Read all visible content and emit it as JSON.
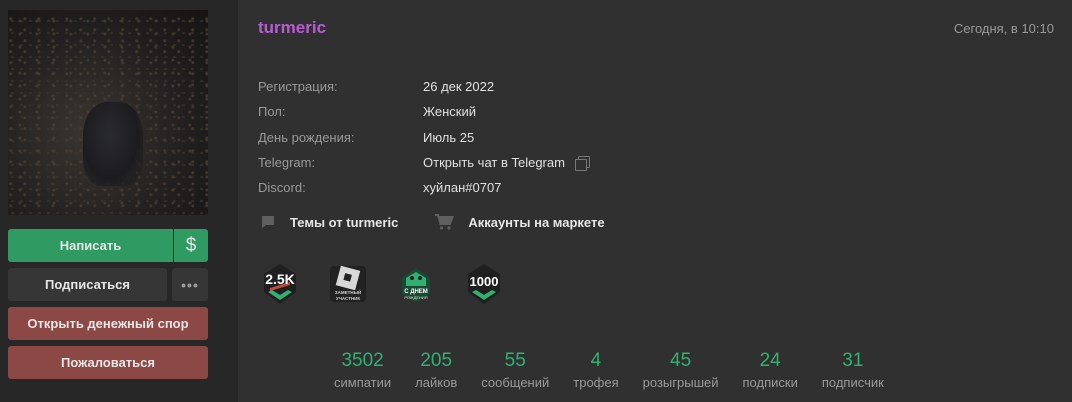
{
  "profile": {
    "username": "turmeric",
    "last_seen": "Сегодня, в 10:10",
    "info": [
      {
        "key": "Регистрация:",
        "value": "26 дек 2022"
      },
      {
        "key": "Пол:",
        "value": "Женский"
      },
      {
        "key": "День рождения:",
        "value": "Июль 25"
      },
      {
        "key": "Telegram:",
        "value": "Открыть чат в Telegram"
      },
      {
        "key": "Discord:",
        "value": "хуйлан#0707"
      }
    ]
  },
  "actions": {
    "write": "Написать",
    "money": "$",
    "follow": "Подписаться",
    "more": "•••",
    "dispute": "Открыть денежный спор",
    "report": "Пожаловаться"
  },
  "links": {
    "threads": "Темы от turmeric",
    "market": "Аккаунты на маркете"
  },
  "trophies": [
    {
      "icon": "2-5k-sympathies-trophy-icon",
      "line1": "2.5K",
      "line2": ""
    },
    {
      "icon": "roblox-participant-trophy-icon",
      "line1": "ЗАМЕТНЫЙ",
      "line2": "УЧАСТНИК"
    },
    {
      "icon": "birthday-cake-trophy-icon",
      "line1": "С ДНЕМ",
      "line2": "РОЖДЕНИЯ"
    },
    {
      "icon": "1000-trophy-icon",
      "line1": "1000",
      "line2": ""
    }
  ],
  "stats": [
    {
      "value": "3502",
      "label": "симпатии"
    },
    {
      "value": "205",
      "label": "лайков"
    },
    {
      "value": "55",
      "label": "сообщений"
    },
    {
      "value": "4",
      "label": "трофея"
    },
    {
      "value": "45",
      "label": "розыгрышей"
    },
    {
      "value": "24",
      "label": "подписки"
    },
    {
      "value": "31",
      "label": "подписчик"
    }
  ],
  "colors": {
    "accent_green": "#2f9a61",
    "danger": "#8c4844",
    "username": "#b85cd3",
    "stat_number": "#2fb271"
  }
}
